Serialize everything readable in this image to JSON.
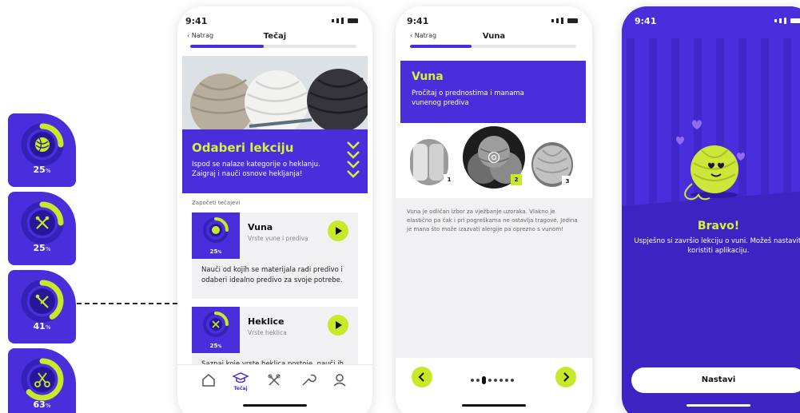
{
  "status_time": "9:41",
  "progress_cards": [
    {
      "percent": "25",
      "icon": "yarn-ball-icon",
      "fraction": 0.25
    },
    {
      "percent": "25",
      "icon": "needles-icon",
      "fraction": 0.25
    },
    {
      "percent": "41",
      "icon": "crochet-hook-icon",
      "fraction": 0.41
    },
    {
      "percent": "63",
      "icon": "scissors-icon",
      "fraction": 0.63
    }
  ],
  "percent_sign": "%",
  "screen1": {
    "back_label": "Natrag",
    "nav_title": "Tečaj",
    "progress": 0.44,
    "banner_title": "Odaberi lekciju",
    "banner_text": "Ispod se nalaze kategorije o heklanju. Zaigraj i nauči osnove hekljanja!",
    "section_label": "Započeti tečajevi",
    "lessons": [
      {
        "title": "Vuna",
        "subtitle": "Vrste vune i prediva",
        "percent": "25",
        "fraction": 0.25,
        "description": "Nauči od kojih se materijala radi predivo i odaberi idealno predivo za svoje potrebe."
      },
      {
        "title": "Heklice",
        "subtitle": "Vrste heklica",
        "percent": "25",
        "fraction": 0.25,
        "description": "Saznaj koje vrste heklica postoje, nauči ih"
      }
    ],
    "tabs": [
      {
        "icon": "home-icon"
      },
      {
        "icon": "graduation-cap-icon",
        "label": "Tečaj"
      },
      {
        "icon": "needles-icon"
      },
      {
        "icon": "tools-icon"
      },
      {
        "icon": "profile-icon"
      }
    ]
  },
  "screen2": {
    "back_label": "Natrag",
    "nav_title": "Vuna",
    "progress": 0.37,
    "banner_title": "Vuna",
    "banner_text": "Pročitaj o prednostima i manama vunenog prediva",
    "yarn_badges": [
      "1",
      "2",
      "3"
    ],
    "body_text": "Vuna je odličan izbor za vježbanje uzoraka. Vlakno je elastično pa čak i pri pogreškama ne ostavlja tragove. Jedina je mana što može izazvati alergije pa oprezno s vunom!",
    "page_index": 2,
    "page_count": 8
  },
  "screen3": {
    "title": "Bravo!",
    "message": "Uspješno si završio lekciju o vuni. Možeš nastaviti koristiti aplikaciju.",
    "button_label": "Nastavi"
  },
  "colors": {
    "brand": "#4a2ddb",
    "accent": "#c8e82a",
    "accent_text": "#d6f23a"
  }
}
